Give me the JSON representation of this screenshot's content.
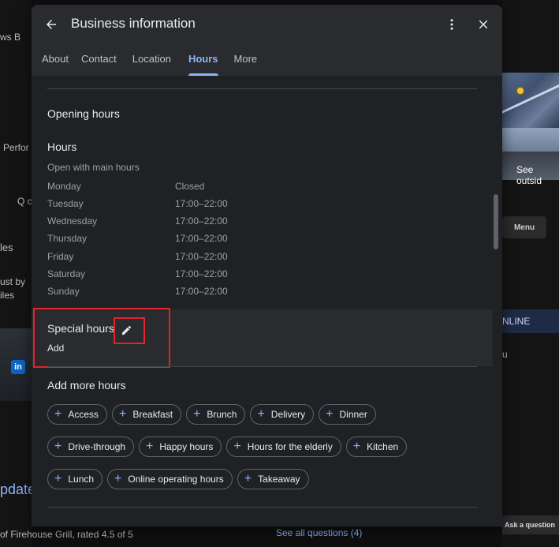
{
  "background": {
    "left_texts": [
      "ws  B",
      "Perfor",
      "Q c",
      "les",
      "ust by",
      "iles",
      "pdate"
    ],
    "right_texts": [
      "See outsid",
      "Menu",
      "NLINE",
      "u",
      "Ask a question"
    ],
    "bottom_text": "of Firehouse Grill, rated 4.5 of 5",
    "bottom_link": "See all questions (4)",
    "linkedin": "in"
  },
  "modal": {
    "title": "Business information",
    "tabs": [
      {
        "label": "About",
        "active": false
      },
      {
        "label": "Contact",
        "active": false
      },
      {
        "label": "Location",
        "active": false
      },
      {
        "label": "Hours",
        "active": true
      },
      {
        "label": "More",
        "active": false
      }
    ]
  },
  "opening_hours": {
    "title": "Opening hours",
    "hours_title": "Hours",
    "hours_subtitle": "Open with main hours",
    "rows": [
      {
        "day": "Monday",
        "time": "Closed"
      },
      {
        "day": "Tuesday",
        "time": "17:00–22:00"
      },
      {
        "day": "Wednesday",
        "time": "17:00–22:00"
      },
      {
        "day": "Thursday",
        "time": "17:00–22:00"
      },
      {
        "day": "Friday",
        "time": "17:00–22:00"
      },
      {
        "day": "Saturday",
        "time": "17:00–22:00"
      },
      {
        "day": "Sunday",
        "time": "17:00–22:00"
      }
    ]
  },
  "special_hours": {
    "title": "Special hours",
    "add_label": "Add"
  },
  "more_hours": {
    "title": "Add more hours",
    "chips_row1": [
      "Access",
      "Breakfast",
      "Brunch",
      "Delivery",
      "Dinner"
    ],
    "chips_row2": [
      "Drive-through",
      "Happy hours",
      "Hours for the elderly",
      "Kitchen"
    ],
    "chips_row3": [
      "Lunch",
      "Online operating hours",
      "Takeaway"
    ]
  },
  "colors": {
    "accent": "#8ab4f8",
    "highlight": "#e3232b"
  }
}
